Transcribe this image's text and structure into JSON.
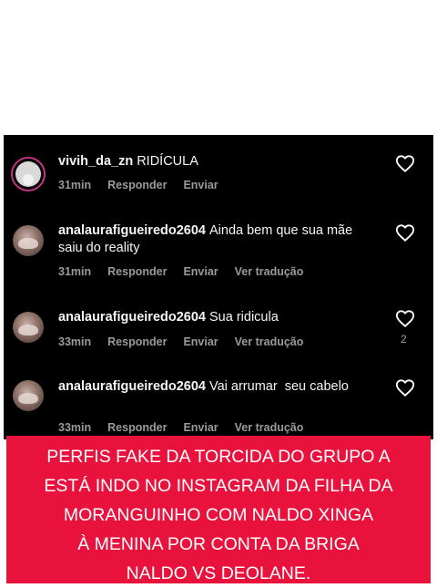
{
  "comments": [
    {
      "username": "vivih_da_zn",
      "text": "RIDÍCULA",
      "time": "31min",
      "reply": "Responder",
      "send": "Enviar",
      "translate": "",
      "likes": ""
    },
    {
      "username": "analaurafigueiredo2604",
      "text": "Ainda bem que sua mãe saiu do reality",
      "time": "31min",
      "reply": "Responder",
      "send": "Enviar",
      "translate": "Ver tradução",
      "likes": ""
    },
    {
      "username": "analaurafigueiredo2604",
      "text": "Sua ridicula",
      "time": "33min",
      "reply": "Responder",
      "send": "Enviar",
      "translate": "Ver tradução",
      "likes": "2"
    },
    {
      "username": "analaurafigueiredo2604",
      "text": "Vai arrumar  seu cabelo",
      "time": "33min",
      "reply": "Responder",
      "send": "Enviar",
      "translate": "Ver tradução",
      "likes": ""
    }
  ],
  "banner": {
    "lines": [
      "PERFIS FAKE DA TORCIDA DO GRUPO A",
      "ESTÁ INDO NO INSTAGRAM DA FILHA DA",
      "MORANGUINHO COM NALDO XINGA",
      "À MENINA POR CONTA DA BRIGA",
      "NALDO VS DEOLANE."
    ],
    "color": "#e8123d"
  },
  "icons": {
    "heart": "heart-icon",
    "avatar": "avatar"
  }
}
